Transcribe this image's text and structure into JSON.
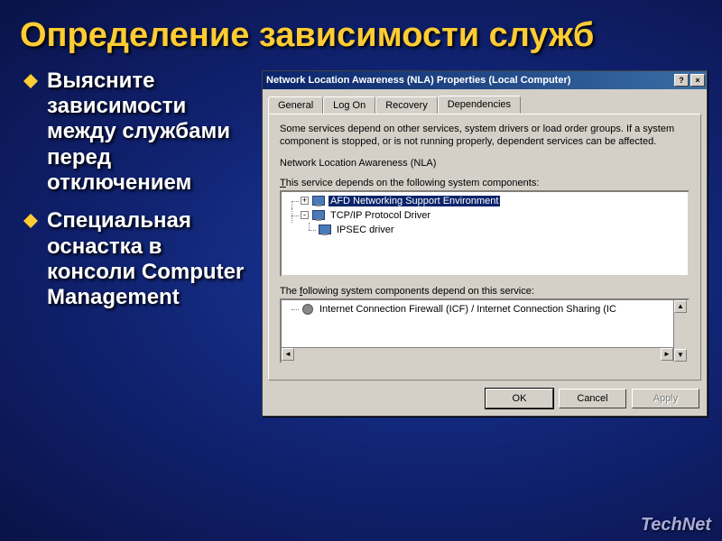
{
  "slide": {
    "title": "Определение зависимости служб",
    "bullets": [
      "Выясните зависимости между службами перед отключением",
      "Специальная оснастка в консоли Computer Management"
    ]
  },
  "dialog": {
    "title": "Network Location Awareness (NLA) Properties (Local Computer)",
    "help_btn": "?",
    "close_btn": "×",
    "tabs": [
      "General",
      "Log On",
      "Recovery",
      "Dependencies"
    ],
    "active_tab": 3,
    "description": "Some services depend on other services, system drivers or load order groups. If a system component is stopped, or is not running properly, dependent services can be affected.",
    "service_name": "Network Location Awareness (NLA)",
    "depends_on_label": "This service depends on the following system components:",
    "depends_on_underline": "T",
    "depends_on_tree": [
      {
        "level": 0,
        "expander": "+",
        "icon": "monitor",
        "label": "AFD Networking Support Environment",
        "selected": true
      },
      {
        "level": 0,
        "expander": "-",
        "icon": "monitor",
        "label": "TCP/IP Protocol Driver",
        "selected": false
      },
      {
        "level": 1,
        "expander": "",
        "icon": "monitor",
        "label": "IPSEC driver",
        "selected": false
      }
    ],
    "depended_by_label": "The following system components depend on this service:",
    "depended_by_underline": "f",
    "depended_by_tree": [
      {
        "level": 0,
        "expander": "",
        "icon": "gear",
        "label": "Internet Connection Firewall (ICF) / Internet Connection Sharing (IC",
        "selected": false
      }
    ],
    "buttons": {
      "ok": "OK",
      "cancel": "Cancel",
      "apply": "Apply"
    }
  },
  "branding": "TechNet"
}
